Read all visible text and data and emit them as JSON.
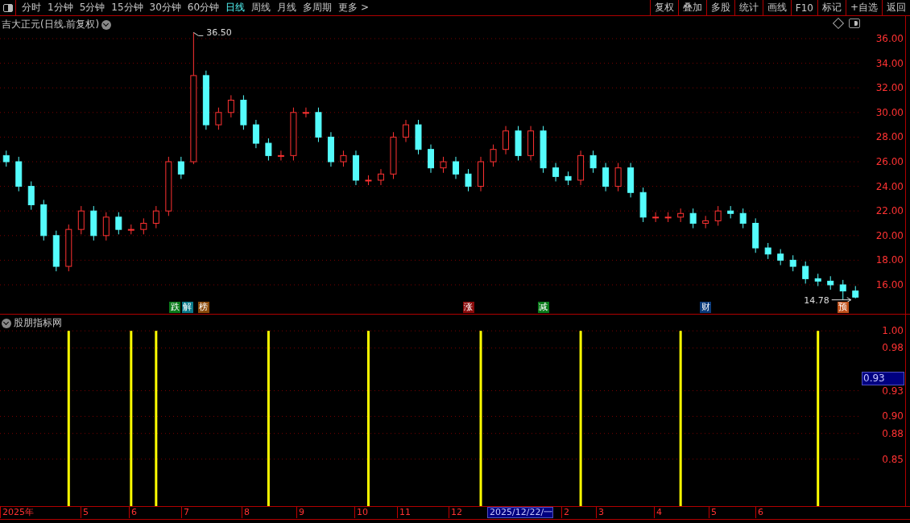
{
  "toolbar": {
    "periods": [
      {
        "label": "分时",
        "selected": false
      },
      {
        "label": "1分钟",
        "selected": false
      },
      {
        "label": "5分钟",
        "selected": false
      },
      {
        "label": "15分钟",
        "selected": false
      },
      {
        "label": "30分钟",
        "selected": false
      },
      {
        "label": "60分钟",
        "selected": false
      },
      {
        "label": "日线",
        "selected": true
      },
      {
        "label": "周线",
        "selected": false
      },
      {
        "label": "月线",
        "selected": false
      },
      {
        "label": "多周期",
        "selected": false
      },
      {
        "label": "更多 >",
        "selected": false
      }
    ],
    "buttons": [
      "复权",
      "叠加",
      "多股",
      "统计",
      "画线",
      "F10",
      "标记",
      "+自选",
      "返回"
    ]
  },
  "price_panel": {
    "title": "吉大正元(日线.前复权)",
    "high_label": "36.50",
    "low_label": "14.78",
    "events": [
      {
        "text": "跌",
        "color": "#0a7a1a"
      },
      {
        "text": "解",
        "color": "#0a7a8a"
      },
      {
        "text": "榜",
        "color": "#8a4a0a"
      },
      {
        "text": "涨",
        "color": "#8a0a0a"
      },
      {
        "text": "减",
        "color": "#0a7a1a"
      },
      {
        "text": "财",
        "color": "#0a3a7a"
      },
      {
        "text": "预",
        "color": "#c0501a"
      }
    ],
    "chart_data": {
      "type": "candlestick",
      "ylim": [
        16,
        36
      ],
      "yticks": [
        {
          "value": 36,
          "label": "36.00"
        },
        {
          "value": 34,
          "label": "34.00"
        },
        {
          "value": 32,
          "label": "32.00"
        },
        {
          "value": 30,
          "label": "30.00"
        },
        {
          "value": 28,
          "label": "28.00"
        },
        {
          "value": 26,
          "label": "26.00"
        },
        {
          "value": 24,
          "label": "24.00"
        },
        {
          "value": 22,
          "label": "22.00"
        },
        {
          "value": 20,
          "label": "20.00"
        },
        {
          "value": 18,
          "label": "18.00"
        },
        {
          "value": 16,
          "label": "16.00"
        }
      ],
      "grid": true,
      "ohlc": [
        [
          26.5,
          26.9,
          25.6,
          26
        ],
        [
          26,
          26.4,
          23.6,
          24
        ],
        [
          24,
          24.4,
          22.1,
          22.5
        ],
        [
          22.5,
          22.9,
          19.6,
          20
        ],
        [
          20,
          20.4,
          17.1,
          17.5
        ],
        [
          17.5,
          20.9,
          17.1,
          20.5
        ],
        [
          20.5,
          22.4,
          20.1,
          22
        ],
        [
          22,
          22.4,
          19.6,
          20
        ],
        [
          20,
          21.9,
          19.6,
          21.5
        ],
        [
          21.5,
          21.9,
          20.1,
          20.5
        ],
        [
          20.5,
          20.9,
          20.1,
          20.5
        ],
        [
          20.5,
          21.4,
          20.1,
          21
        ],
        [
          21,
          22.4,
          20.6,
          22
        ],
        [
          22,
          26.4,
          21.6,
          26
        ],
        [
          26,
          26.4,
          24.6,
          25
        ],
        [
          26,
          36.5,
          25.8,
          33
        ],
        [
          33,
          33.4,
          28.6,
          29
        ],
        [
          29,
          30.4,
          28.6,
          30
        ],
        [
          30,
          31.4,
          29.6,
          31
        ],
        [
          31,
          31.4,
          28.6,
          29
        ],
        [
          29,
          29.4,
          27.1,
          27.5
        ],
        [
          27.5,
          27.9,
          26.1,
          26.5
        ],
        [
          26.5,
          26.9,
          26.1,
          26.5
        ],
        [
          26.5,
          30.4,
          26.1,
          30
        ],
        [
          30,
          30.4,
          29.6,
          30
        ],
        [
          30,
          30.4,
          27.6,
          28
        ],
        [
          28,
          28.4,
          25.6,
          26
        ],
        [
          26,
          26.9,
          25.6,
          26.5
        ],
        [
          26.5,
          26.9,
          24.1,
          24.5
        ],
        [
          24.5,
          24.9,
          24.1,
          24.5
        ],
        [
          24.5,
          25.4,
          24.1,
          25
        ],
        [
          25,
          28.4,
          24.6,
          28
        ],
        [
          28,
          29.4,
          27.6,
          29
        ],
        [
          29,
          29.4,
          26.6,
          27
        ],
        [
          27,
          27.4,
          25.1,
          25.5
        ],
        [
          25.5,
          26.4,
          25.1,
          26
        ],
        [
          26,
          26.4,
          24.6,
          25
        ],
        [
          25,
          25.4,
          23.6,
          24
        ],
        [
          24,
          26.4,
          23.6,
          26
        ],
        [
          26,
          27.4,
          25.6,
          27
        ],
        [
          27,
          28.9,
          26.6,
          28.5
        ],
        [
          28.5,
          28.9,
          26.1,
          26.5
        ],
        [
          26.5,
          28.9,
          26.1,
          28.5
        ],
        [
          28.5,
          28.9,
          25.1,
          25.5
        ],
        [
          25.5,
          25.9,
          24.4,
          24.8
        ],
        [
          24.8,
          25.2,
          24.1,
          24.5
        ],
        [
          24.5,
          26.9,
          24.1,
          26.5
        ],
        [
          26.5,
          26.9,
          25.1,
          25.5
        ],
        [
          25.5,
          25.9,
          23.6,
          24
        ],
        [
          24,
          25.9,
          23.6,
          25.5
        ],
        [
          25.5,
          25.9,
          23.1,
          23.5
        ],
        [
          23.5,
          23.9,
          21.1,
          21.5
        ],
        [
          21.5,
          21.9,
          21.1,
          21.5
        ],
        [
          21.5,
          21.9,
          21.1,
          21.5
        ],
        [
          21.5,
          22.2,
          21.1,
          21.8
        ],
        [
          21.8,
          22.2,
          20.6,
          21
        ],
        [
          21,
          21.6,
          20.6,
          21.2
        ],
        [
          21.2,
          22.4,
          20.8,
          22
        ],
        [
          22,
          22.4,
          21.4,
          21.8
        ],
        [
          21.8,
          22.2,
          20.6,
          21
        ],
        [
          21,
          21.4,
          18.6,
          19
        ],
        [
          19,
          19.4,
          18.1,
          18.5
        ],
        [
          18.5,
          18.9,
          17.6,
          18
        ],
        [
          18,
          18.4,
          17.1,
          17.5
        ],
        [
          17.5,
          17.9,
          16.1,
          16.5
        ],
        [
          16.5,
          16.9,
          15.9,
          16.3
        ],
        [
          16.3,
          16.7,
          15.6,
          16
        ],
        [
          16,
          16.4,
          14.78,
          15.5
        ],
        [
          15.5,
          15.9,
          14.9,
          15
        ]
      ]
    }
  },
  "indicator_panel": {
    "title": "股朋指标网",
    "current_value": "0.93",
    "chart_data": {
      "type": "bar",
      "ylim": [
        0.795,
        1.019
      ],
      "grid": true,
      "yticks": [
        {
          "value": 1,
          "label": "1.00"
        },
        {
          "value": 0.98,
          "label": "0.98"
        },
        {
          "value": 0.93,
          "label": "0.93"
        },
        {
          "value": 0.9,
          "label": "0.90"
        },
        {
          "value": 0.88,
          "label": "0.88"
        },
        {
          "value": 0.85,
          "label": "0.85"
        }
      ],
      "series": [
        {
          "color": "#ffff00",
          "values": [
            null,
            null,
            null,
            null,
            null,
            1,
            null,
            null,
            null,
            null,
            1,
            null,
            1,
            null,
            null,
            null,
            null,
            null,
            null,
            null,
            null,
            1,
            null,
            null,
            null,
            null,
            null,
            null,
            null,
            1,
            null,
            null,
            null,
            null,
            null,
            null,
            null,
            null,
            1,
            null,
            null,
            null,
            null,
            null,
            null,
            null,
            1,
            null,
            null,
            null,
            null,
            null,
            null,
            null,
            1,
            null,
            null,
            null,
            null,
            null,
            null,
            null,
            null,
            null,
            null,
            1,
            null,
            null,
            null
          ]
        }
      ]
    }
  },
  "date_axis": {
    "labels": [
      {
        "text": "2025年",
        "selected": false
      },
      {
        "text": "5",
        "selected": false
      },
      {
        "text": "6",
        "selected": false
      },
      {
        "text": "7",
        "selected": false
      },
      {
        "text": "8",
        "selected": false
      },
      {
        "text": "9",
        "selected": false
      },
      {
        "text": "10",
        "selected": false
      },
      {
        "text": "11",
        "selected": false
      },
      {
        "text": "12",
        "selected": false
      },
      {
        "text": "2025/12/22/一",
        "selected": true
      },
      {
        "text": "2",
        "selected": false
      },
      {
        "text": "3",
        "selected": false
      },
      {
        "text": "4",
        "selected": false
      },
      {
        "text": "5",
        "selected": false
      },
      {
        "text": "6",
        "selected": false
      }
    ]
  }
}
